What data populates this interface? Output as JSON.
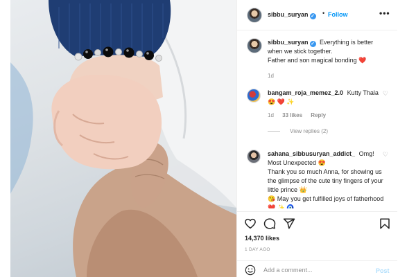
{
  "header": {
    "username": "sibbu_suryan",
    "follow_label": "Follow",
    "separator": "•",
    "more_glyph": "•••"
  },
  "caption": {
    "username": "sibbu_suryan",
    "line1": "Everything is better when we stick together.",
    "line2": "Father and son magical bonding ❤️",
    "time": "1d"
  },
  "comments": [
    {
      "username": "bangam_roja_memez_2.0",
      "text": "Kutty Thala 😍 ❤️ ✨",
      "time": "1d",
      "likes": "33 likes",
      "reply_label": "Reply",
      "view_replies": "View replies (2)"
    },
    {
      "username": "sahana_sibbusuryan_addict_",
      "text1": "Omg! Most Unexpected 😍",
      "text2": "Thank you so much Anna, for showing us the glimpse of the cute tiny fingers of your little prince 👑",
      "text3": "😘 May you get fulfilled joys of fatherhood ❤️ ✨ 🧿"
    }
  ],
  "actions": {
    "like_icon": "heart-outline-icon",
    "comment_icon": "comment-icon",
    "share_icon": "paper-plane-icon",
    "save_icon": "bookmark-icon"
  },
  "likes_count": "14,370 likes",
  "time_ago": "1 DAY AGO",
  "add_comment": {
    "placeholder": "Add a comment...",
    "post_label": "Post"
  },
  "colors": {
    "accent": "#0095f6",
    "verified": "#3897f0",
    "heart_red": "#ed4956",
    "muted": "#8e8e8e",
    "beanie": "#1f3d73"
  }
}
